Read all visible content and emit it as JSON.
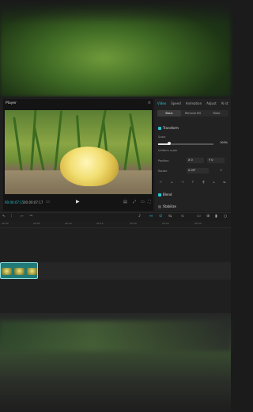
{
  "player": {
    "title": "Player",
    "current_time": "00:00:07:15",
    "duration": "00:00:07:17"
  },
  "inspector": {
    "tabs": [
      "Video",
      "Speed",
      "Animation",
      "Adjust",
      "AI st"
    ],
    "subtabs": [
      "Basic",
      "Remove BG",
      "Mask"
    ],
    "transform_label": "Transform",
    "scale_label": "Scale",
    "scale_value": "100%",
    "scale_level": 0.2,
    "uniform_scale_label": "Uniform scale",
    "position_label": "Position",
    "position_x": "0",
    "position_y": "0",
    "rotate_label": "Rotate",
    "rotate_value": "0.00°",
    "blend_label": "Blend",
    "stabilize_label": "Stabilize"
  },
  "timeline": {
    "ticks": [
      "00:00",
      "00:05",
      "00:10",
      "00:15",
      "00:20",
      "00:25",
      "00:30"
    ]
  },
  "colors": {
    "accent": "#27c3d0",
    "clip": "#1f7a78"
  }
}
